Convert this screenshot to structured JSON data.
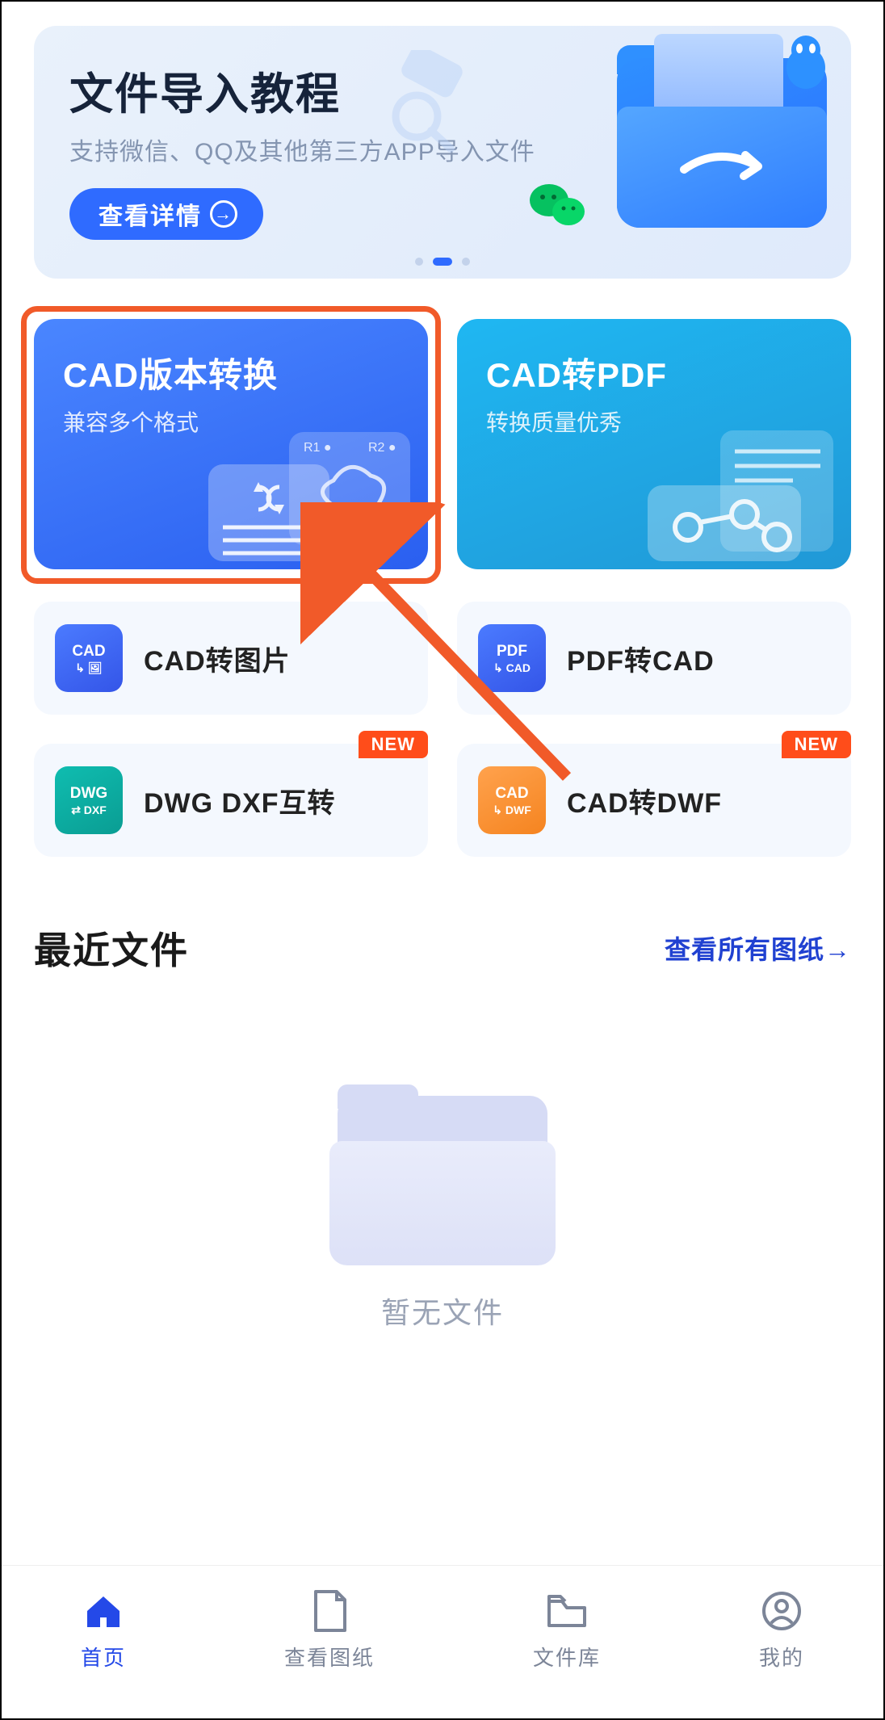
{
  "banner": {
    "title": "文件导入教程",
    "subtitle": "支持微信、QQ及其他第三方APP导入文件",
    "button": "查看详情"
  },
  "features": {
    "left": {
      "title": "CAD版本转换",
      "subtitle": "兼容多个格式"
    },
    "right": {
      "title": "CAD转PDF",
      "subtitle": "转换质量优秀"
    }
  },
  "tiles": [
    {
      "label": "CAD转图片",
      "iconTop": "CAD",
      "color": "blue",
      "badge": ""
    },
    {
      "label": "PDF转CAD",
      "iconTop": "PDF",
      "color": "blue",
      "badge": ""
    },
    {
      "label": "DWG DXF互转",
      "iconTop": "DWG",
      "color": "green",
      "badge": "NEW"
    },
    {
      "label": "CAD转DWF",
      "iconTop": "CAD",
      "color": "orange",
      "badge": "NEW"
    }
  ],
  "recent": {
    "title": "最近文件",
    "link": "查看所有图纸→",
    "empty": "暂无文件"
  },
  "nav": {
    "home": "首页",
    "view": "查看图纸",
    "files": "文件库",
    "me": "我的"
  }
}
